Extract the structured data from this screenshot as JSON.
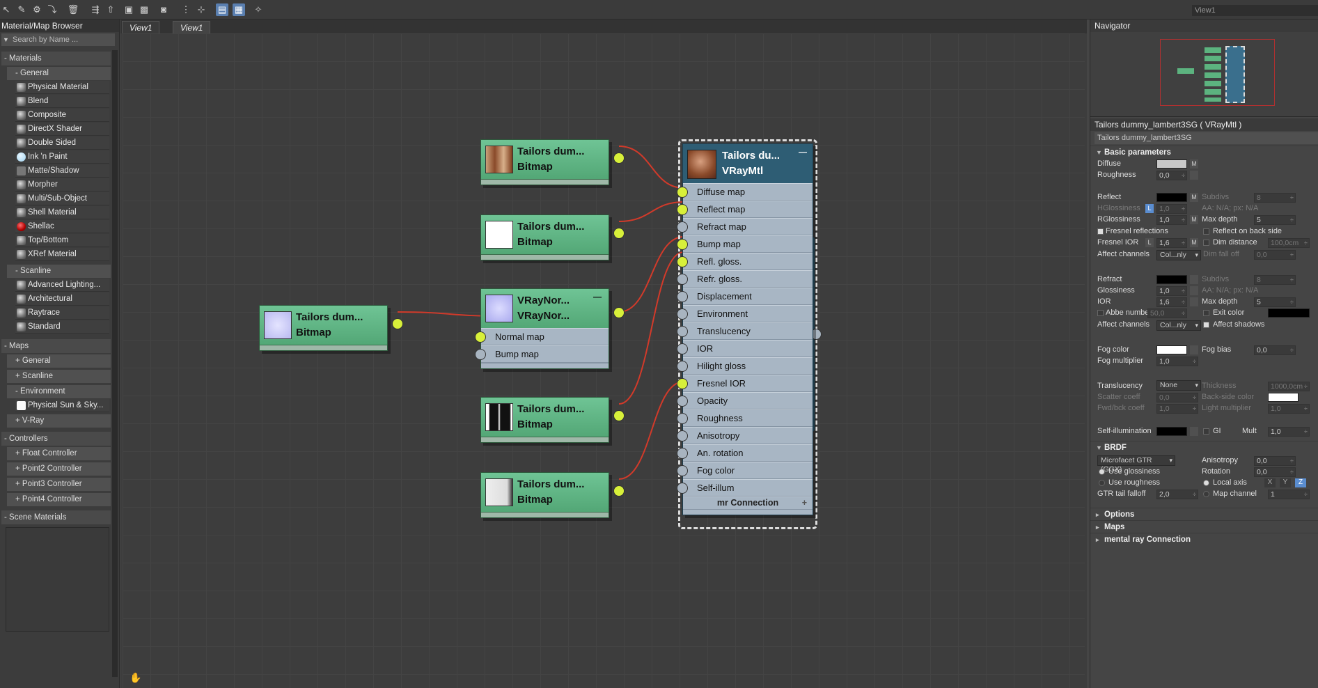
{
  "view_field": "View1",
  "browser": {
    "title": "Material/Map Browser",
    "search_placeholder": "Search by Name ...",
    "materials_label": "- Materials",
    "general_label": "- General",
    "general_items": [
      "Physical Material",
      "Blend",
      "Composite",
      "DirectX Shader",
      "Double Sided",
      "Ink 'n Paint",
      "Matte/Shadow",
      "Morpher",
      "Multi/Sub-Object",
      "Shell Material",
      "Shellac",
      "Top/Bottom",
      "XRef Material"
    ],
    "scanline_label": "- Scanline",
    "scanline_items": [
      "Advanced Lighting...",
      "Architectural",
      "Raytrace",
      "Standard"
    ],
    "maps_label": "- Maps",
    "maps_general": "+ General",
    "maps_scanline": "+ Scanline",
    "maps_environment": "- Environment",
    "env_item": "Physical Sun & Sky...",
    "vray": "+ V-Ray",
    "controllers_label": "- Controllers",
    "controllers": [
      "+ Float Controller",
      "+ Point2 Controller",
      "+ Point3 Controller",
      "+ Point4 Controller"
    ],
    "scene_materials": "- Scene Materials"
  },
  "view": {
    "tabs": [
      "View1",
      "View1"
    ]
  },
  "nodes": {
    "bmp_diffuse": {
      "t1": "Tailors dum...",
      "t2": "Bitmap"
    },
    "bmp_reflect": {
      "t1": "Tailors dum...",
      "t2": "Bitmap"
    },
    "bmp_normal": {
      "t1": "Tailors dum...",
      "t2": "Bitmap"
    },
    "vraynormal": {
      "t1": "VRayNor...",
      "t2": "VRayNor...",
      "minus": "—",
      "slots": [
        "Normal map",
        "Bump map"
      ]
    },
    "bmp_gloss": {
      "t1": "Tailors dum...",
      "t2": "Bitmap"
    },
    "bmp_ior": {
      "t1": "Tailors dum...",
      "t2": "Bitmap"
    },
    "vraymtl": {
      "t1": "Tailors du...",
      "t2": "VRayMtl",
      "minus": "—",
      "mr": "mr Connection",
      "plus": "+",
      "slots": [
        "Diffuse map",
        "Reflect map",
        "Refract map",
        "Bump map",
        "Refl. gloss.",
        "Refr. gloss.",
        "Displacement",
        "Environment",
        "Translucency",
        "IOR",
        "Hilight gloss",
        "Fresnel IOR",
        "Opacity",
        "Roughness",
        "Anisotropy",
        "An. rotation",
        "Fog color",
        "Self-illum"
      ]
    }
  },
  "navigator": {
    "title": "Navigator"
  },
  "material": {
    "title": "Tailors dummy_lambert3SG  ( VRayMtl )",
    "name": "Tailors dummy_lambert3SG",
    "basic": "Basic parameters",
    "diffuse": "Diffuse",
    "roughness": "Roughness",
    "roughness_val": "0,0",
    "reflect": "Reflect",
    "subdivs": "Subdivs",
    "subdivs_val": "8",
    "hgloss": "HGlossiness",
    "hgloss_val": "1,0",
    "aa": "AA: N/A; px: N/A",
    "rgloss": "RGlossiness",
    "rgloss_val": "1,0",
    "maxdepth": "Max depth",
    "maxdepth_val": "5",
    "fresnel": "Fresnel reflections",
    "reflect_back": "Reflect on back side",
    "fresnel_ior": "Fresnel IOR",
    "fresnel_ior_val": "1,6",
    "dim_distance": "Dim distance",
    "dim_distance_val": "100,0cm",
    "affect": "Affect channels",
    "affect_val": "Col...nly",
    "dim_falloff": "Dim fall off",
    "dim_falloff_val": "0,0",
    "refract": "Refract",
    "glossiness": "Glossiness",
    "glossiness_val": "1,0",
    "ior": "IOR",
    "ior_val": "1,6",
    "abbe": "Abbe number",
    "abbe_val": "50,0",
    "exit_color": "Exit color",
    "affect_shadows": "Affect shadows",
    "fog_color": "Fog color",
    "fog_bias": "Fog bias",
    "fog_bias_val": "0,0",
    "fog_mult": "Fog multiplier",
    "fog_mult_val": "1,0",
    "translucency": "Translucency",
    "transl_val": "None",
    "thickness": "Thickness",
    "thickness_val": "1000,0cm",
    "scatter": "Scatter coeff",
    "scatter_val": "0,0",
    "backside": "Back-side color",
    "fwdbck": "Fwd/bck coeff",
    "fwdbck_val": "1,0",
    "lightmult": "Light multiplier",
    "lightmult_val": "1,0",
    "selfillum": "Self-illumination",
    "gi": "GI",
    "mult": "Mult",
    "mult_val": "1,0",
    "brdf": "BRDF",
    "brdf_type": "Microfacet GTR (GGX)",
    "anisotropy": "Anisotropy",
    "aniso_val": "0,0",
    "use_gloss": "Use glossiness",
    "rotation": "Rotation",
    "rotation_val": "0,0",
    "use_rough": "Use roughness",
    "local_axis": "Local axis",
    "x": "X",
    "y": "Y",
    "z": "Z",
    "gtr": "GTR tail falloff",
    "gtr_val": "2,0",
    "map_channel": "Map channel",
    "map_channel_val": "1",
    "M": "M",
    "L": "L",
    "options": "Options",
    "maps": "Maps",
    "mr": "mental ray Connection"
  },
  "colors": {
    "node_green": "#5cb37f",
    "vray_blue": "#2e5d74",
    "wire": "#d23a2a",
    "socket_on": "#d8f03a"
  }
}
